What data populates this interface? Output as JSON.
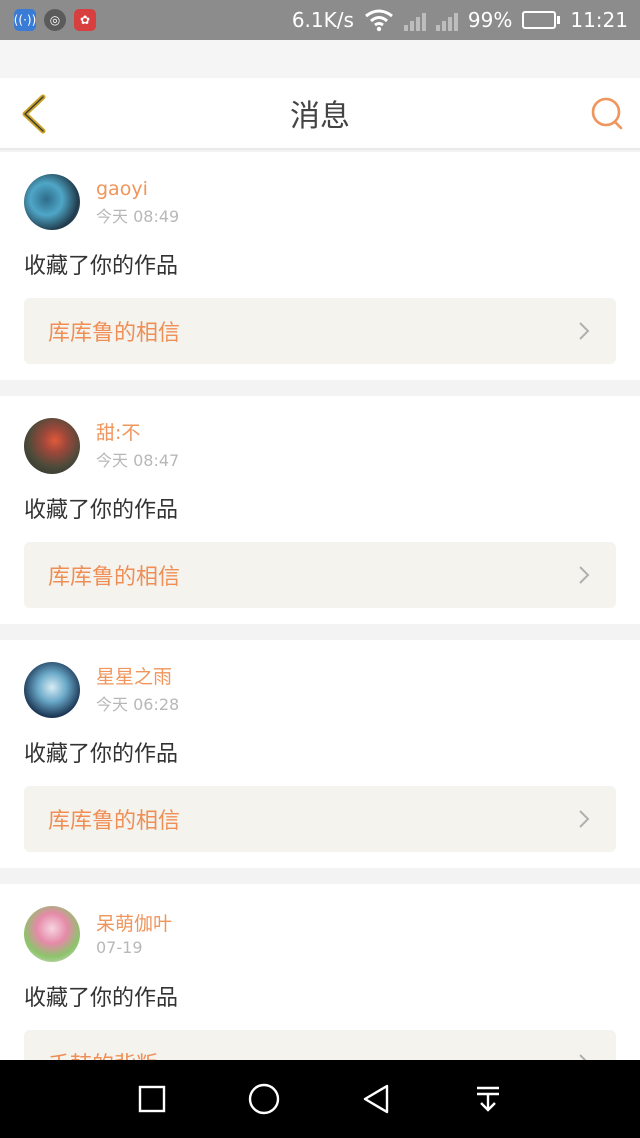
{
  "status_bar": {
    "speed": "6.1K/s",
    "battery": "99%",
    "time": "11:21"
  },
  "header": {
    "title": "消息"
  },
  "messages": [
    {
      "name": "gaoyi",
      "time": "今天 08:49",
      "action": "收藏了你的作品",
      "ref_title": "库库鲁的相信"
    },
    {
      "name": "甜:不",
      "time": "今天 08:47",
      "action": "收藏了你的作品",
      "ref_title": "库库鲁的相信"
    },
    {
      "name": "星星之雨",
      "time": "今天 06:28",
      "action": "收藏了你的作品",
      "ref_title": "库库鲁的相信"
    },
    {
      "name": "呆萌伽叶",
      "time": "07-19",
      "action": "收藏了你的作品",
      "ref_title": "千韩的背叛"
    }
  ],
  "colors": {
    "accent": "#f0955b",
    "back_icon": "#c9a227",
    "ref_bg": "#f4f3ee"
  }
}
